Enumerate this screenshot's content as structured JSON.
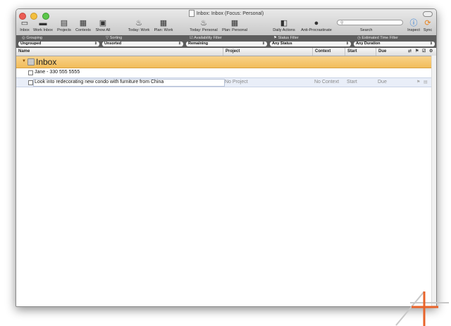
{
  "window": {
    "title": "Inbox: Inbox (Focus: Personal)"
  },
  "toolbar": {
    "buttons": [
      {
        "label": "Inbox",
        "icon": "inbox-tray-icon"
      },
      {
        "label": "Work Inbox",
        "icon": "inbox-tray-icon"
      },
      {
        "label": "Projects",
        "icon": "projects-icon"
      },
      {
        "label": "Contexts",
        "icon": "contexts-icon"
      },
      {
        "label": "Show All",
        "icon": "show-all-icon"
      },
      {
        "label": "Today: Work",
        "icon": "flame-icon"
      },
      {
        "label": "Plan: Work",
        "icon": "calendar-icon"
      },
      {
        "label": "Today: Personal",
        "icon": "flame-icon"
      },
      {
        "label": "Plan: Personal",
        "icon": "calendar-icon"
      },
      {
        "label": "Daily Actions",
        "icon": "mug-icon"
      },
      {
        "label": "Anti-Procrastinate",
        "icon": "bomb-icon"
      }
    ],
    "search_label": "Search",
    "inspect_label": "Inspect",
    "sync_label": "Sync"
  },
  "filters": {
    "grouping": {
      "title": "Grouping",
      "value": "Ungrouped"
    },
    "sorting": {
      "title": "Sorting",
      "value": "Unsorted"
    },
    "availability": {
      "title": "Availability Filter",
      "value": "Remaining"
    },
    "status": {
      "title": "Status Filter",
      "value": "Any Status"
    },
    "duration": {
      "title": "Estimated Time Filter",
      "value": "Any Duration"
    }
  },
  "columns": {
    "name": "Name",
    "project": "Project",
    "context": "Context",
    "start": "Start",
    "due": "Due"
  },
  "inbox": {
    "label": "Inbox"
  },
  "tasks": [
    {
      "name": "Jane - 330 555 5555"
    },
    {
      "name": "Look into redecorating new condo with furniture from China",
      "project": "No Project",
      "context": "No Context",
      "start": "Start",
      "due": "Due"
    }
  ],
  "colors": {
    "inbox_row": "#f2bd5b",
    "filter_bar": "#5d5d5d",
    "selected_row": "#e9eef8",
    "logo_orange": "#e8632a"
  }
}
